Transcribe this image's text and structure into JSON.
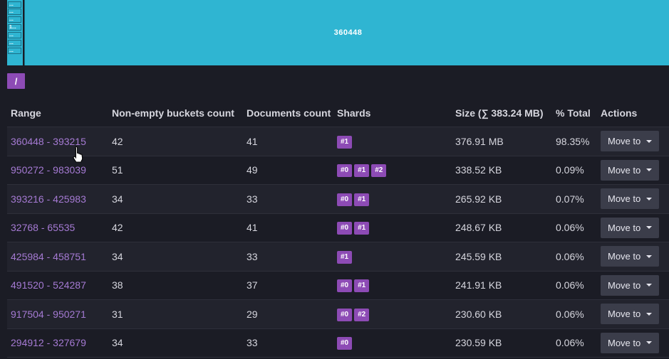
{
  "treemap": {
    "main_label": "360448",
    "mini_labels": [
      "...",
      "...",
      "...",
      "1...",
      "...",
      "...",
      "..."
    ]
  },
  "path": {
    "label": "/"
  },
  "table": {
    "headers": {
      "range": "Range",
      "buckets": "Non-empty buckets count",
      "documents": "Documents count",
      "shards": "Shards",
      "size": "Size (∑ 383.24 MB)",
      "total": "% Total",
      "actions": "Actions"
    },
    "rows": [
      {
        "range": "360448 - 393215",
        "buckets": "42",
        "documents": "41",
        "shards": [
          "#1"
        ],
        "size": "376.91 MB",
        "total": "98.35%",
        "action": "Move to"
      },
      {
        "range": "950272 - 983039",
        "buckets": "51",
        "documents": "49",
        "shards": [
          "#0",
          "#1",
          "#2"
        ],
        "size": "338.52 KB",
        "total": "0.09%",
        "action": "Move to"
      },
      {
        "range": "393216 - 425983",
        "buckets": "34",
        "documents": "33",
        "shards": [
          "#0",
          "#1"
        ],
        "size": "265.92 KB",
        "total": "0.07%",
        "action": "Move to"
      },
      {
        "range": "32768 - 65535",
        "buckets": "42",
        "documents": "41",
        "shards": [
          "#0",
          "#1"
        ],
        "size": "248.67 KB",
        "total": "0.06%",
        "action": "Move to"
      },
      {
        "range": "425984 - 458751",
        "buckets": "34",
        "documents": "33",
        "shards": [
          "#1"
        ],
        "size": "245.59 KB",
        "total": "0.06%",
        "action": "Move to"
      },
      {
        "range": "491520 - 524287",
        "buckets": "38",
        "documents": "37",
        "shards": [
          "#0",
          "#1"
        ],
        "size": "241.91 KB",
        "total": "0.06%",
        "action": "Move to"
      },
      {
        "range": "917504 - 950271",
        "buckets": "31",
        "documents": "29",
        "shards": [
          "#0",
          "#2"
        ],
        "size": "230.60 KB",
        "total": "0.06%",
        "action": "Move to"
      },
      {
        "range": "294912 - 327679",
        "buckets": "34",
        "documents": "33",
        "shards": [
          "#0"
        ],
        "size": "230.59 KB",
        "total": "0.06%",
        "action": "Move to"
      }
    ]
  },
  "colors": {
    "treemap": "#2fb5d2",
    "accent": "#8d4bb5",
    "link": "#a57ad3",
    "background": "#1b1c25"
  },
  "icons": {
    "cursor": "hand-pointer-icon",
    "caret": "caret-down-icon"
  }
}
